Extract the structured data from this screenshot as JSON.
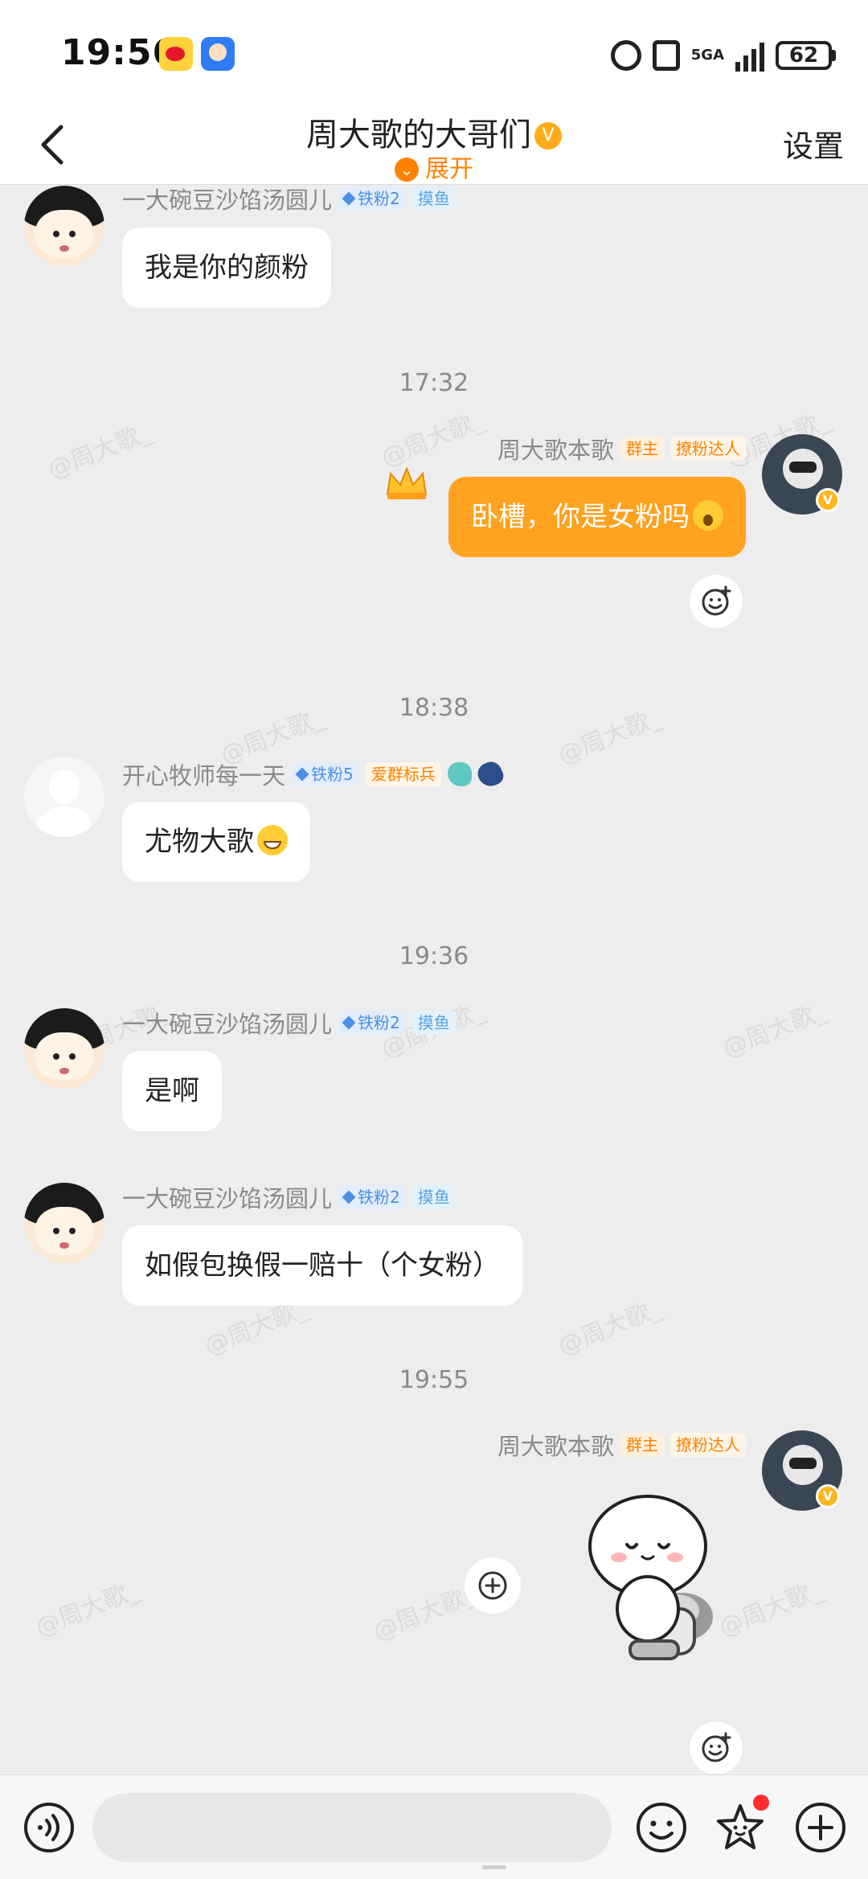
{
  "status_bar": {
    "time": "19:56",
    "network": "5GA",
    "battery": "62"
  },
  "header": {
    "title": "周大歌的大哥们",
    "expand_label": "展开",
    "settings_label": "设置"
  },
  "watermark_text": "@周大歌_",
  "messages": [
    {
      "sender": "一大碗豆沙馅汤圆儿",
      "tags": [
        "铁粉2",
        "摸鱼"
      ],
      "text": "我是你的颜粉"
    },
    {
      "timestamp": "17:32"
    },
    {
      "sender": "周大歌本歌",
      "tags": [
        "群主",
        "撩粉达人"
      ],
      "text": "卧槽，你是女粉吗"
    },
    {
      "timestamp": "18:38"
    },
    {
      "sender": "开心牧师每一天",
      "tags": [
        "铁粉5",
        "爱群标兵"
      ],
      "text": "尤物大歌"
    },
    {
      "timestamp": "19:36"
    },
    {
      "sender": "一大碗豆沙馅汤圆儿",
      "tags": [
        "铁粉2",
        "摸鱼"
      ],
      "text": "是啊"
    },
    {
      "sender": "一大碗豆沙馅汤圆儿",
      "tags": [
        "铁粉2",
        "摸鱼"
      ],
      "text": "如假包换假一赔十（个女粉）"
    },
    {
      "timestamp": "19:55"
    },
    {
      "sender": "周大歌本歌",
      "tags": [
        "群主",
        "撩粉达人"
      ],
      "sticker": "toilet-sticker"
    }
  ],
  "input_bar": {
    "placeholder": ""
  },
  "colors": {
    "accent_orange": "#ff8200",
    "own_bubble": "#ffa21f",
    "chat_background": "#ededed",
    "fan_tag_blue": "#4d8ee6",
    "notification_dot": "#ff2d2d"
  }
}
